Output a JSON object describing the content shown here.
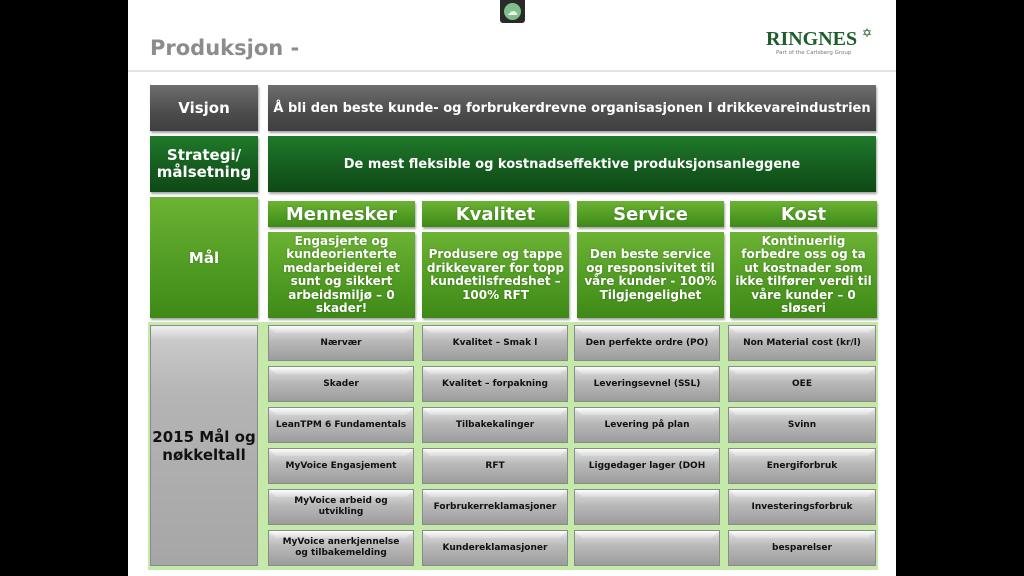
{
  "slide": {
    "title": "Produksjon -",
    "top_icon": "cloud-icon",
    "logo": {
      "brand": "RINGNES",
      "star_glyph": "✡",
      "tagline": "Part of the Carlsberg Group"
    }
  },
  "rows": {
    "visjon": {
      "label": "Visjon",
      "text": "Å bli den beste kunde- og forbrukerdrevne organisasjonen I drikkevareindustrien"
    },
    "strategi": {
      "label": "Strategi/ målsetning",
      "text": "De mest fleksible og kostnadseffektive produksjonsanleggene"
    },
    "maal": {
      "label": "Mål",
      "columns": [
        {
          "header": "Mennesker",
          "text": "Engasjerte og kundeorienterte medarbeiderei et sunt og sikkert arbeidsmiljø – 0 skader!"
        },
        {
          "header": "Kvalitet",
          "text": "Produsere og tappe drikkevarer for topp kundetilsfredshet – 100% RFT"
        },
        {
          "header": "Service",
          "text": "Den beste service og responsivitet til våre kunder - 100% Tilgjengelighet"
        },
        {
          "header": "Kost",
          "text": "Kontinuerlig forbedre oss og ta ut kostnader som ikke tilfører verdi til våre kunder – 0 sløseri"
        }
      ]
    },
    "kpi": {
      "label": "2015 Mål og nøkkeltall",
      "columns": [
        [
          "Nærvær",
          "Skader",
          "LeanTPM 6 Fundamentals",
          "MyVoice Engasjement",
          "MyVoice arbeid og utvikling",
          "MyVoice anerkjennelse og tilbakemelding"
        ],
        [
          "Kvalitet – Smak l",
          "Kvalitet – forpakning",
          "Tilbakekalinger",
          "RFT",
          "Forbrukerreklamasjoner",
          "Kundereklamasjoner"
        ],
        [
          "Den perfekte ordre (PO)",
          "Leveringsevnel (SSL)",
          "Levering på plan",
          "Liggedager lager (DOH",
          "",
          ""
        ],
        [
          "Non Material cost (kr/l)",
          "OEE",
          "Svinn",
          "Energiforbruk",
          "Investeringsforbruk",
          "besparelser"
        ]
      ]
    }
  }
}
